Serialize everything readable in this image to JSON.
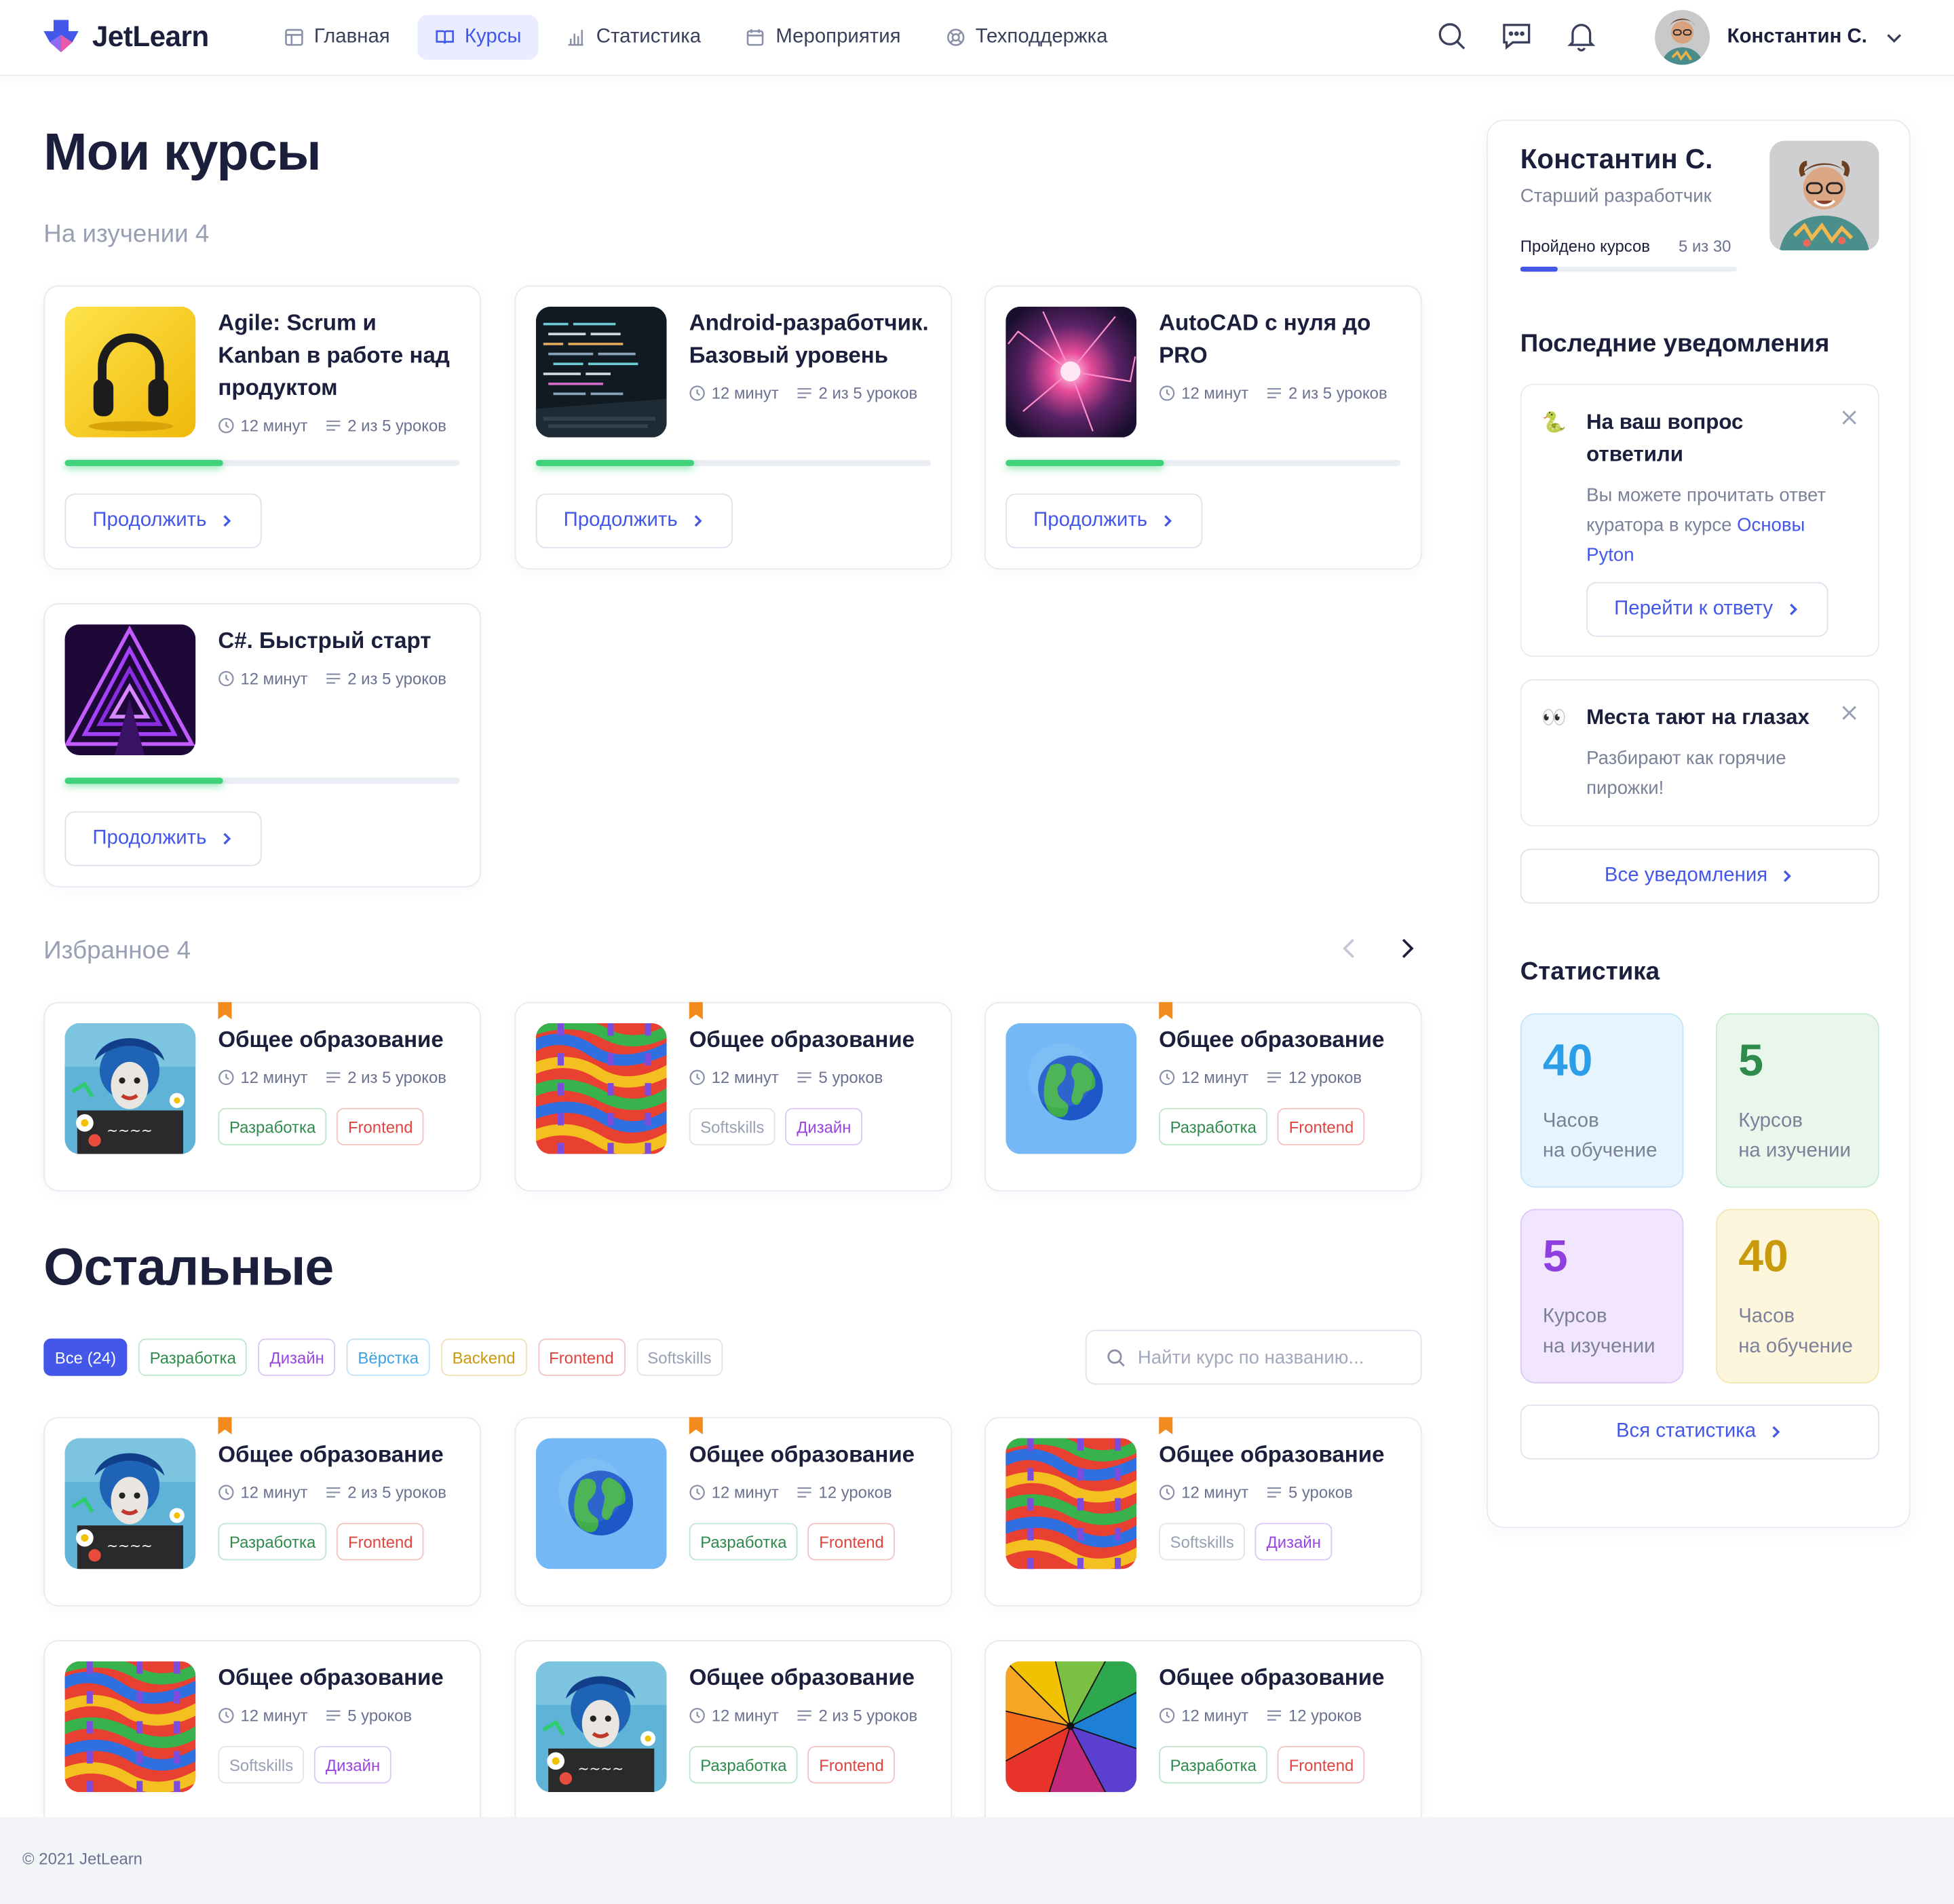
{
  "app": {
    "name": "JetLearn",
    "copyright": "© 2021 JetLearn"
  },
  "nav": [
    {
      "label": "Главная",
      "icon": "home-icon",
      "active": false
    },
    {
      "label": "Курсы",
      "icon": "book-icon",
      "active": true
    },
    {
      "label": "Статистика",
      "icon": "bar-chart-icon",
      "active": false
    },
    {
      "label": "Мероприятия",
      "icon": "calendar-icon",
      "active": false
    },
    {
      "label": "Техподдержка",
      "icon": "lifebuoy-icon",
      "active": false
    }
  ],
  "header": {
    "user_name": "Константин С."
  },
  "page": {
    "title": "Мои курсы",
    "studying_label": "На изучении 4",
    "favorites_label": "Избранное 4",
    "others_title": "Остальные"
  },
  "studying": [
    {
      "title": "Agile: Scrum и Kanban в работе над продуктом",
      "time": "12 минут",
      "lessons": "2 из 5 уроков",
      "progress": 0.4,
      "button": "Продолжить",
      "image": "headphones"
    },
    {
      "title": "Android-разработчик. Базовый уровень",
      "time": "12 минут",
      "lessons": "2 из 5 уроков",
      "progress": 0.4,
      "button": "Продолжить",
      "image": "code"
    },
    {
      "title": "AutoCAD с нуля до PRO",
      "time": "12 минут",
      "lessons": "2 из 5 уроков",
      "progress": 0.4,
      "button": "Продолжить",
      "image": "plasma"
    },
    {
      "title": "C#. Быстрый старт",
      "time": "12 минут",
      "lessons": "2 из 5 уроков",
      "progress": 0.4,
      "button": "Продолжить",
      "image": "neon"
    }
  ],
  "favorites": [
    {
      "title": "Общее образование",
      "time": "12 минут",
      "lessons": "2 из 5 уроков",
      "tags": [
        "Разработка",
        "Frontend"
      ],
      "image": "graffiti"
    },
    {
      "title": "Общее образование",
      "time": "12 минут",
      "lessons": "5 уроков",
      "tags": [
        "Softskills",
        "Дизайн"
      ],
      "image": "pattern"
    },
    {
      "title": "Общее образование",
      "time": "12 минут",
      "lessons": "12 уроков",
      "tags": [
        "Разработка",
        "Frontend"
      ],
      "image": "globe"
    }
  ],
  "filters": [
    "Все (24)",
    "Разработка",
    "Дизайн",
    "Вёрстка",
    "Backend",
    "Frontend",
    "Softskills"
  ],
  "search": {
    "placeholder": "Найти курс по названию..."
  },
  "others": [
    {
      "title": "Общее образование",
      "time": "12 минут",
      "lessons": "2 из 5 уроков",
      "tags": [
        "Разработка",
        "Frontend"
      ],
      "image": "graffiti",
      "bookmark": true
    },
    {
      "title": "Общее образование",
      "time": "12 минут",
      "lessons": "12 уроков",
      "tags": [
        "Разработка",
        "Frontend"
      ],
      "image": "globe",
      "bookmark": true
    },
    {
      "title": "Общее образование",
      "time": "12 минут",
      "lessons": "5 уроков",
      "tags": [
        "Softskills",
        "Дизайн"
      ],
      "image": "pattern",
      "bookmark": true
    },
    {
      "title": "Общее образование",
      "time": "12 минут",
      "lessons": "5 уроков",
      "tags": [
        "Softskills",
        "Дизайн"
      ],
      "image": "pattern",
      "bookmark": false
    },
    {
      "title": "Общее образование",
      "time": "12 минут",
      "lessons": "2 из 5 уроков",
      "tags": [
        "Разработка",
        "Frontend"
      ],
      "image": "graffiti",
      "bookmark": false
    },
    {
      "title": "Общее образование",
      "time": "12 минут",
      "lessons": "12 уроков",
      "tags": [
        "Разработка",
        "Frontend"
      ],
      "image": "umbrella",
      "bookmark": false
    }
  ],
  "profile": {
    "name": "Константин С.",
    "role": "Старший разработчик",
    "progress_label": "Пройдено курсов",
    "progress_value": "5 из 30",
    "progress": 0.17
  },
  "notifications": {
    "title": "Последние уведомления",
    "items": [
      {
        "emoji": "🐍",
        "title": "На ваш вопрос ответили",
        "body": "Вы можете прочитать ответ куратора в курсе ",
        "link": "Основы Pyton",
        "button": "Перейти к ответу"
      },
      {
        "emoji": "👀",
        "title": "Места тают на глазах",
        "body": "Разбирают как горячие пирожки!"
      }
    ],
    "all_button": "Все уведомления"
  },
  "stats": {
    "title": "Статистика",
    "items": [
      {
        "value": "40",
        "line1": "Часов",
        "line2": "на обучение",
        "color": "#2c9ee8",
        "bg": "#e6f4fd",
        "border": "#c7e5f8"
      },
      {
        "value": "5",
        "line1": "Курсов",
        "line2": "на изучении",
        "color": "#2e8b4c",
        "bg": "#e8f6ec",
        "border": "#c9ead3"
      },
      {
        "value": "5",
        "line1": "Курсов",
        "line2": "на изучении",
        "color": "#8f3fe0",
        "bg": "#f1e6fd",
        "border": "#ddc8f6"
      },
      {
        "value": "40",
        "line1": "Часов",
        "line2": "на обучение",
        "color": "#c99a0c",
        "bg": "#fdf6dd",
        "border": "#f3e5b3"
      }
    ],
    "all_button": "Вся статистика"
  }
}
